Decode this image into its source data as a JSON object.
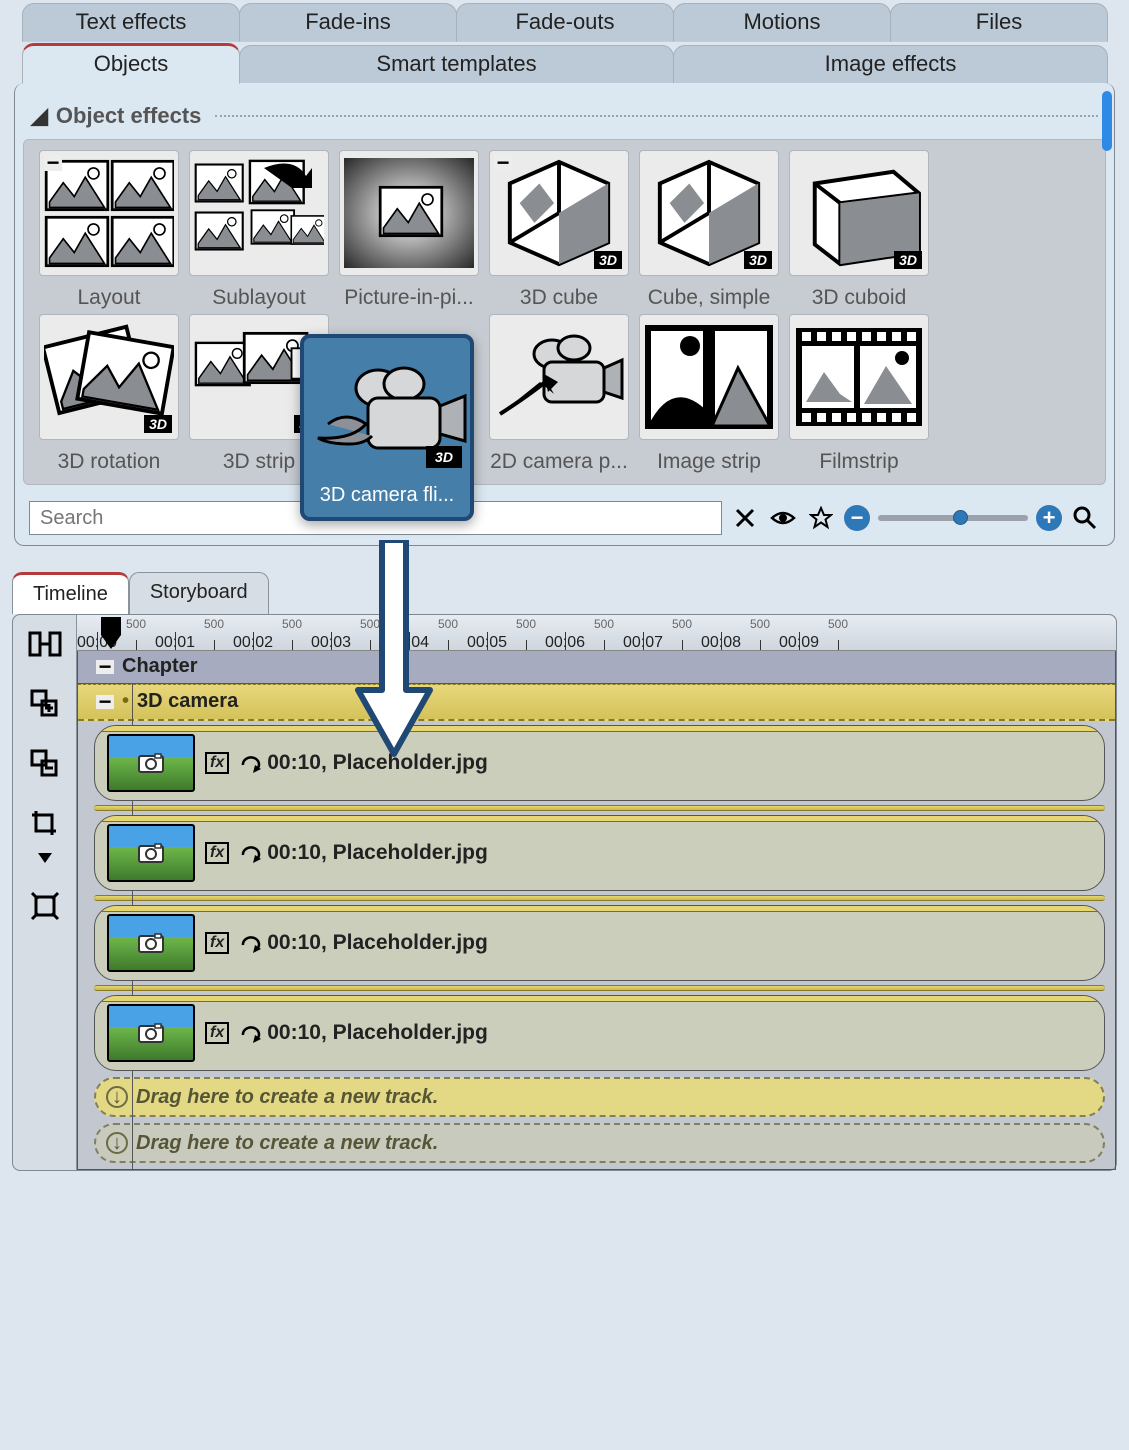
{
  "tabs_row1": [
    {
      "label": "Text effects",
      "active": false
    },
    {
      "label": "Fade-ins",
      "active": false
    },
    {
      "label": "Fade-outs",
      "active": false
    },
    {
      "label": "Motions",
      "active": false
    },
    {
      "label": "Files",
      "active": false
    }
  ],
  "tabs_row2": [
    {
      "label": "Objects",
      "active": true
    },
    {
      "label": "Smart templates",
      "active": false
    },
    {
      "label": "Image effects",
      "active": false
    }
  ],
  "effects": {
    "section_title": "Object effects",
    "items": [
      {
        "label": "Layout",
        "icon": "layout",
        "badge3d": false,
        "minus": true
      },
      {
        "label": "Sublayout",
        "icon": "sublayout",
        "badge3d": false,
        "minus": false
      },
      {
        "label": "Picture-in-pi...",
        "icon": "pip",
        "badge3d": false,
        "minus": false
      },
      {
        "label": "3D cube",
        "icon": "cube",
        "badge3d": true,
        "minus": true
      },
      {
        "label": "Cube, simple",
        "icon": "cube",
        "badge3d": true,
        "minus": false
      },
      {
        "label": "3D cuboid",
        "icon": "cuboid",
        "badge3d": true,
        "minus": false
      },
      {
        "label": "3D rotation",
        "icon": "rotation",
        "badge3d": true,
        "minus": false
      },
      {
        "label": "3D strip",
        "icon": "strip3d",
        "badge3d": true,
        "minus": false
      },
      {
        "label": "3D camera fli...",
        "icon": "camfly",
        "badge3d": true,
        "minus": false,
        "selected": true
      },
      {
        "label": "2D camera p...",
        "icon": "campan",
        "badge3d": false,
        "minus": false
      },
      {
        "label": "Image strip",
        "icon": "imagestrip",
        "badge3d": false,
        "minus": false
      },
      {
        "label": "Filmstrip",
        "icon": "filmstrip",
        "badge3d": false,
        "minus": false
      }
    ],
    "search_placeholder": "Search"
  },
  "lower_tabs": [
    {
      "label": "Timeline",
      "active": true
    },
    {
      "label": "Storyboard",
      "active": false
    }
  ],
  "ruler": {
    "marks": [
      "00:00",
      "00:01",
      "00:02",
      "00:03",
      "00:04",
      "00:05",
      "00:06",
      "00:07",
      "00:08",
      "00:09"
    ],
    "minor": "500"
  },
  "timeline": {
    "chapter_label": "Chapter",
    "track_label": "3D camera",
    "clips": [
      {
        "duration": "00:10",
        "name": "Placeholder.jpg"
      },
      {
        "duration": "00:10",
        "name": "Placeholder.jpg"
      },
      {
        "duration": "00:10",
        "name": "Placeholder.jpg"
      },
      {
        "duration": "00:10",
        "name": "Placeholder.jpg"
      }
    ],
    "drop_hint": "Drag here to create a new track."
  }
}
